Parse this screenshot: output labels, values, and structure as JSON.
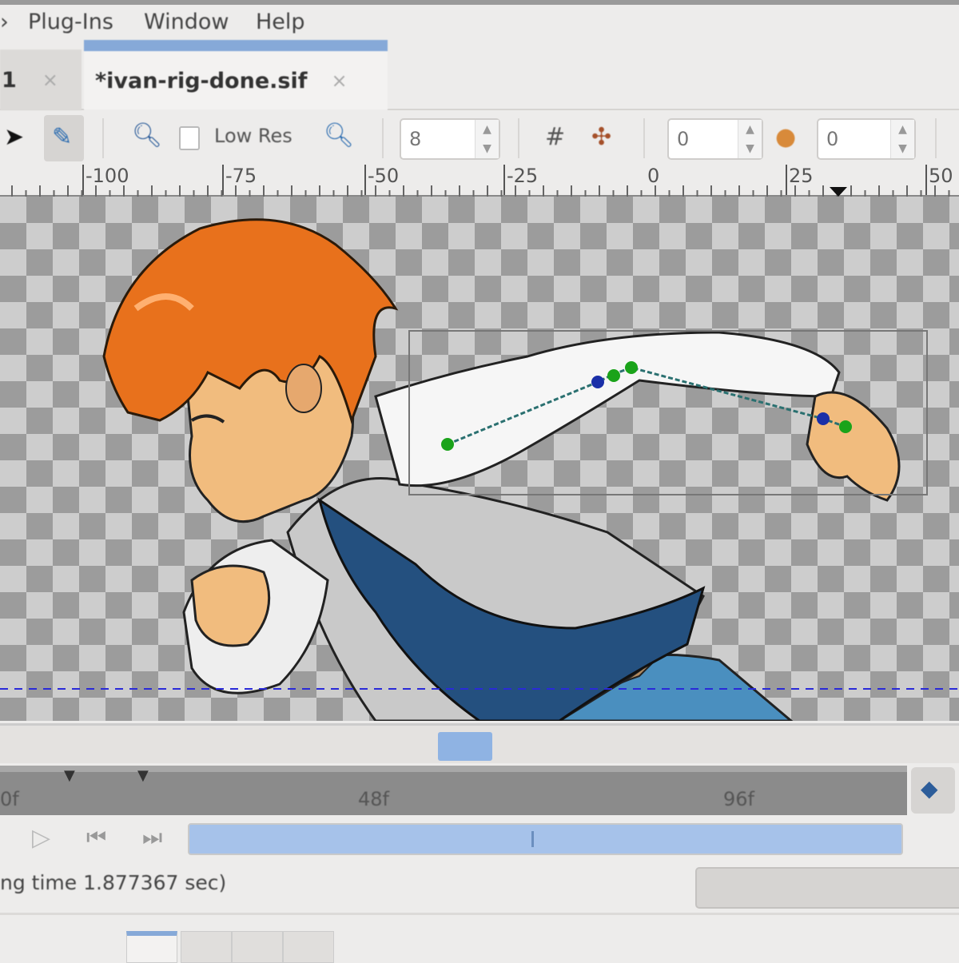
{
  "menubar": {
    "items": [
      "Plug-Ins",
      "Window",
      "Help"
    ]
  },
  "tabs": [
    {
      "label": "1",
      "close": "×",
      "active": false
    },
    {
      "label": "*ivan-rig-done.sif",
      "close": "×",
      "active": true
    }
  ],
  "toolbar": {
    "low_res_label": "Low Res",
    "low_res_checked": false,
    "quality_value": "8",
    "onion_past_value": "0",
    "onion_future_value": "0",
    "icons": [
      "transform-tool-icon",
      "smooth-move-tool-icon",
      "zoom-out-icon",
      "zoom-in-icon",
      "grid-icon",
      "guides-icon",
      "onion-skin-icon"
    ]
  },
  "ruler": {
    "labels": [
      "-100",
      "-75",
      "-50",
      "-25",
      "0",
      "25",
      "50"
    ]
  },
  "timeline": {
    "labels": [
      "0f",
      "48f",
      "96f"
    ]
  },
  "status": {
    "text": "ng time 1.877367 sec)"
  },
  "colors": {
    "accent": "#86a9d8",
    "hair": "#e8711c",
    "jacket": "#24507f"
  }
}
